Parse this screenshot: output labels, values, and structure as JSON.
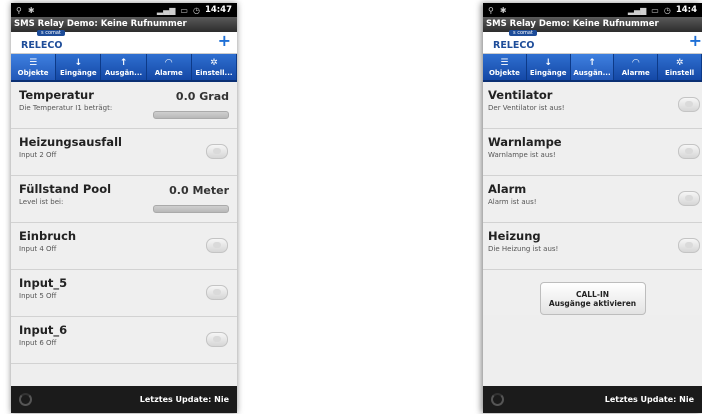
{
  "status_bar": {
    "left_icons": [
      "usb-icon",
      "android-icon"
    ],
    "right_icons": [
      "signal-icon",
      "battery-icon",
      "alarm-clock-icon"
    ],
    "time_left": "14:47",
    "time_right": "14:4"
  },
  "app": {
    "title": "SMS Relay Demo: Keine Rufnummer",
    "logo_small": "s comat",
    "logo": "RELECO",
    "plus": "+"
  },
  "tabs": [
    {
      "label": "Objekte",
      "icon": "layers-icon",
      "glyph": "☰"
    },
    {
      "label": "Eingänge",
      "icon": "arrow-down-icon",
      "glyph": "↓"
    },
    {
      "label": "Ausgän...",
      "icon": "arrow-up-icon",
      "glyph": "↑"
    },
    {
      "label": "Alarme",
      "icon": "signal-waves-icon",
      "glyph": "◠"
    },
    {
      "label": "Einstell...",
      "icon": "gear-icon",
      "glyph": "✲"
    }
  ],
  "tabs_right": [
    {
      "label": "Objekte"
    },
    {
      "label": "Eingänge"
    },
    {
      "label": "Ausgän..."
    },
    {
      "label": "Alarme"
    },
    {
      "label": "Einstell"
    }
  ],
  "left_list": [
    {
      "title": "Temperatur",
      "subtitle": "Die Temperatur I1 beträgt:",
      "value": "0.0 Grad",
      "level": 0
    },
    {
      "title": "Heizungsausfall",
      "subtitle": "Input 2 Off"
    },
    {
      "title": "Füllstand Pool",
      "subtitle": "Level ist bei:",
      "value": "0.0 Meter",
      "level": 0
    },
    {
      "title": "Einbruch",
      "subtitle": "Input 4 Off"
    },
    {
      "title": "Input_5",
      "subtitle": "Input 5 Off"
    },
    {
      "title": "Input_6",
      "subtitle": "Input 6 Off"
    }
  ],
  "right_list": [
    {
      "title": "Ventilator",
      "subtitle": "Der Ventilator ist aus!"
    },
    {
      "title": "Warnlampe",
      "subtitle": "Warnlampe ist aus!"
    },
    {
      "title": "Alarm",
      "subtitle": "Alarm ist aus!"
    },
    {
      "title": "Heizung",
      "subtitle": "Die Heizung ist aus!"
    }
  ],
  "call_in": {
    "line1": "CALL-IN",
    "line2": "Ausgänge aktivieren"
  },
  "footer": {
    "left_text": "Letztes Update: Nie",
    "right_text": "Letztes Update: Nie"
  },
  "colors": {
    "accent": "#1d4c99",
    "tab_bar": "#1f5bbd"
  }
}
